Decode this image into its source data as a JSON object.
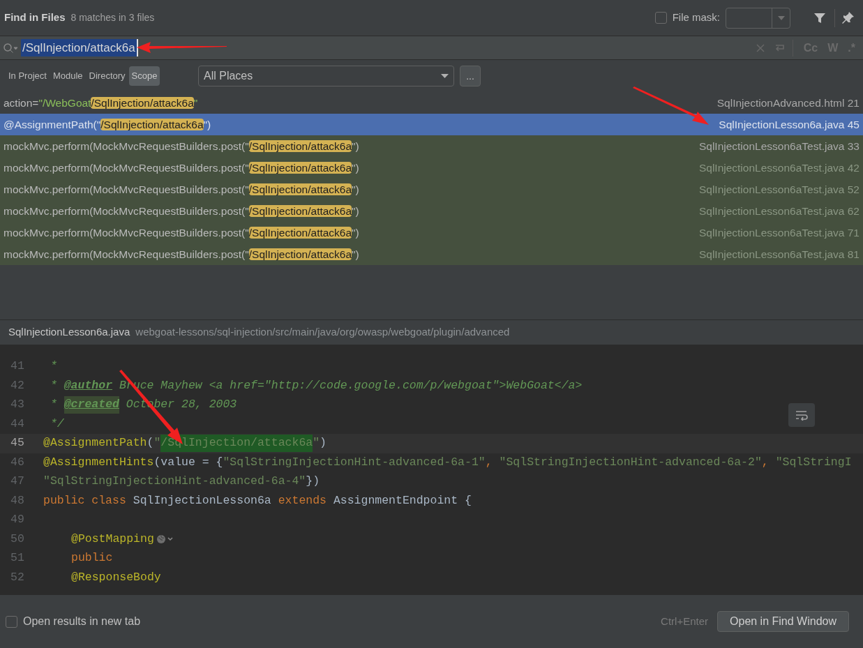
{
  "header": {
    "title": "Find in Files",
    "match_summary": "8 matches in 3 files",
    "file_mask": {
      "label": "File mask:",
      "checked": false
    }
  },
  "search": {
    "query": "/SqlInjection/attack6a",
    "toggles": [
      {
        "label": "Cc",
        "selected": false
      },
      {
        "label": "W",
        "selected": false
      },
      {
        "label": ".*",
        "selected": false
      }
    ]
  },
  "scope_tabs": [
    {
      "label": "In Project",
      "selected": false
    },
    {
      "label": "Module",
      "selected": false
    },
    {
      "label": "Directory",
      "selected": false
    },
    {
      "label": "Scope",
      "selected": true
    }
  ],
  "scope_select": {
    "value": "All Places"
  },
  "more_button": "...",
  "results": [
    {
      "segments": [
        {
          "text": "action=",
          "kind": "plain"
        },
        {
          "text": "\"/WebGoat",
          "kind": "string"
        },
        {
          "text": "/SqlInjection/attack6a",
          "kind": "match"
        },
        {
          "text": "\"",
          "kind": "string"
        }
      ],
      "file": "SqlInjectionAdvanced.html 21",
      "selected": false,
      "kind": "source",
      "file_dimmed": false
    },
    {
      "segments": [
        {
          "text": "@AssignmentPath(\"",
          "kind": "plain"
        },
        {
          "text": "/SqlInjection/attack6a",
          "kind": "match"
        },
        {
          "text": "\")",
          "kind": "plain"
        }
      ],
      "file": "SqlInjectionLesson6a.java 45",
      "selected": true,
      "kind": "source",
      "file_dimmed": false
    },
    {
      "segments": [
        {
          "text": "mockMvc.perform(MockMvcRequestBuilders.post(\"",
          "kind": "plain"
        },
        {
          "text": "/SqlInjection/attack6a",
          "kind": "match"
        },
        {
          "text": "\")",
          "kind": "plain"
        }
      ],
      "file": "SqlInjectionLesson6aTest.java 33",
      "selected": false,
      "kind": "test",
      "file_dimmed": false
    },
    {
      "segments": [
        {
          "text": "mockMvc.perform(MockMvcRequestBuilders.post(\"",
          "kind": "plain"
        },
        {
          "text": "/SqlInjection/attack6a",
          "kind": "match"
        },
        {
          "text": "\")",
          "kind": "plain"
        }
      ],
      "file": "SqlInjectionLesson6aTest.java 42",
      "selected": false,
      "kind": "test",
      "file_dimmed": true
    },
    {
      "segments": [
        {
          "text": "mockMvc.perform(MockMvcRequestBuilders.post(\"",
          "kind": "plain"
        },
        {
          "text": "/SqlInjection/attack6a",
          "kind": "match"
        },
        {
          "text": "\")",
          "kind": "plain"
        }
      ],
      "file": "SqlInjectionLesson6aTest.java 52",
      "selected": false,
      "kind": "test",
      "file_dimmed": true
    },
    {
      "segments": [
        {
          "text": "mockMvc.perform(MockMvcRequestBuilders.post(\"",
          "kind": "plain"
        },
        {
          "text": "/SqlInjection/attack6a",
          "kind": "match"
        },
        {
          "text": "\")",
          "kind": "plain"
        }
      ],
      "file": "SqlInjectionLesson6aTest.java 62",
      "selected": false,
      "kind": "test",
      "file_dimmed": true
    },
    {
      "segments": [
        {
          "text": "mockMvc.perform(MockMvcRequestBuilders.post(\"",
          "kind": "plain"
        },
        {
          "text": "/SqlInjection/attack6a",
          "kind": "match"
        },
        {
          "text": "\")",
          "kind": "plain"
        }
      ],
      "file": "SqlInjectionLesson6aTest.java 71",
      "selected": false,
      "kind": "test",
      "file_dimmed": true
    },
    {
      "segments": [
        {
          "text": "mockMvc.perform(MockMvcRequestBuilders.post(\"",
          "kind": "plain"
        },
        {
          "text": "/SqlInjection/attack6a",
          "kind": "match"
        },
        {
          "text": "\")",
          "kind": "plain"
        }
      ],
      "file": "SqlInjectionLesson6aTest.java 81",
      "selected": false,
      "kind": "test",
      "file_dimmed": true
    }
  ],
  "preview": {
    "file_name": "SqlInjectionLesson6a.java",
    "path": "webgoat-lessons/sql-injection/src/main/java/org/owasp/webgoat/plugin/advanced",
    "lines": [
      {
        "number": "41",
        "current": false,
        "tokens": [
          {
            "text": " *",
            "kind": "comment"
          }
        ]
      },
      {
        "number": "42",
        "current": false,
        "tokens": [
          {
            "text": " * ",
            "kind": "comment"
          },
          {
            "text": "@author",
            "kind": "doc_tag"
          },
          {
            "text": " Bruce Mayhew <a href=\"http://code.google.com/p/webgoat\">WebGoat</a>",
            "kind": "comment"
          }
        ]
      },
      {
        "number": "43",
        "current": false,
        "tokens": [
          {
            "text": " * ",
            "kind": "comment"
          },
          {
            "text": "@created",
            "kind": "doc_tag_marked"
          },
          {
            "text": " October 28, 2003",
            "kind": "comment"
          }
        ]
      },
      {
        "number": "44",
        "current": false,
        "tokens": [
          {
            "text": " */",
            "kind": "comment"
          }
        ]
      },
      {
        "number": "45",
        "current": true,
        "tokens": [
          {
            "text": "@AssignmentPath",
            "kind": "annotation"
          },
          {
            "text": "(",
            "kind": "plain"
          },
          {
            "text": "\"",
            "kind": "string"
          },
          {
            "text": "/SqlInjection/attack6a",
            "kind": "match"
          },
          {
            "text": "\"",
            "kind": "string"
          },
          {
            "text": ")",
            "kind": "plain"
          }
        ]
      },
      {
        "number": "46",
        "current": false,
        "tokens": [
          {
            "text": "@AssignmentHints",
            "kind": "annotation"
          },
          {
            "text": "(value = {",
            "kind": "plain"
          },
          {
            "text": "\"SqlStringInjectionHint-advanced-6a-1\"",
            "kind": "string"
          },
          {
            "text": ", ",
            "kind": "keyword"
          },
          {
            "text": "\"SqlStringInjectionHint-advanced-6a-2\"",
            "kind": "string"
          },
          {
            "text": ", ",
            "kind": "keyword"
          },
          {
            "text": "\"SqlStringI",
            "kind": "string"
          }
        ]
      },
      {
        "number": "47",
        "current": false,
        "tokens": [
          {
            "text": "\"SqlStringInjectionHint-advanced-6a-4\"",
            "kind": "string"
          },
          {
            "text": "})",
            "kind": "plain"
          }
        ]
      },
      {
        "number": "48",
        "current": false,
        "tokens": [
          {
            "text": "public class ",
            "kind": "keyword"
          },
          {
            "text": "SqlInjectionLesson6a ",
            "kind": "plain"
          },
          {
            "text": "extends ",
            "kind": "keyword"
          },
          {
            "text": "AssignmentEndpoint {",
            "kind": "plain"
          }
        ]
      },
      {
        "number": "49",
        "current": false
      },
      {
        "number": "50",
        "current": false,
        "indented": true,
        "tokens": [
          {
            "text": "@PostMapping",
            "kind": "annotation"
          },
          {
            "kind": "globe"
          }
        ]
      },
      {
        "number": "51",
        "current": false,
        "indented": true,
        "tokens": [
          {
            "text": "public",
            "kind": "keyword"
          }
        ]
      },
      {
        "number": "52",
        "current": false,
        "indented": true,
        "tokens": [
          {
            "text": "@ResponseBody",
            "kind": "annotation"
          }
        ]
      }
    ]
  },
  "footer": {
    "new_tab": {
      "label": "Open results in new tab",
      "checked": false
    },
    "shortcut": "Ctrl+Enter",
    "open_button": "Open in Find Window"
  }
}
